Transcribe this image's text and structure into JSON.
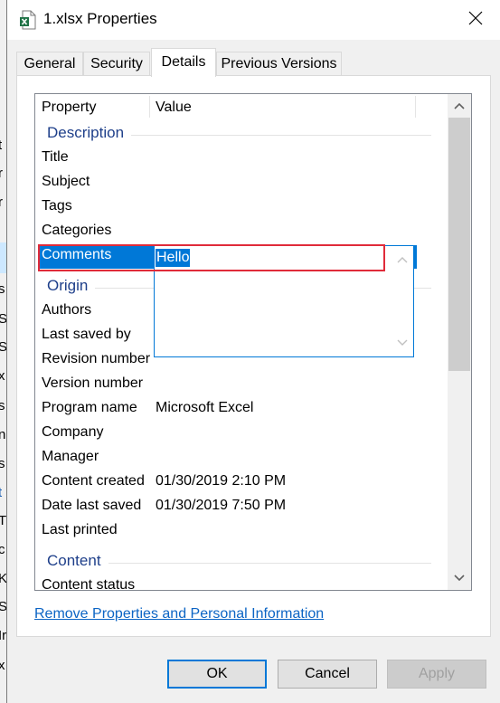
{
  "window": {
    "title": "1.xlsx Properties"
  },
  "tabs": [
    {
      "label": "General"
    },
    {
      "label": "Security"
    },
    {
      "label": "Details"
    },
    {
      "label": "Previous Versions"
    }
  ],
  "list": {
    "header": {
      "property": "Property",
      "value": "Value"
    },
    "groups": {
      "description": "Description",
      "origin": "Origin",
      "content": "Content"
    },
    "rows": {
      "title": {
        "p": "Title",
        "v": ""
      },
      "subject": {
        "p": "Subject",
        "v": ""
      },
      "tags": {
        "p": "Tags",
        "v": ""
      },
      "categories": {
        "p": "Categories",
        "v": ""
      },
      "comments": {
        "p": "Comments",
        "v": "Hello"
      },
      "authors": {
        "p": "Authors",
        "v": ""
      },
      "last_saved_by": {
        "p": "Last saved by",
        "v": ""
      },
      "revision_number": {
        "p": "Revision number",
        "v": ""
      },
      "version_number": {
        "p": "Version number",
        "v": ""
      },
      "program_name": {
        "p": "Program name",
        "v": "Microsoft Excel"
      },
      "company": {
        "p": "Company",
        "v": ""
      },
      "manager": {
        "p": "Manager",
        "v": ""
      },
      "content_created": {
        "p": "Content created",
        "v": "01/30/2019 2:10 PM"
      },
      "date_last_saved": {
        "p": "Date last saved",
        "v": "01/30/2019 7:50 PM"
      },
      "last_printed": {
        "p": "Last printed",
        "v": ""
      },
      "content_status": {
        "p": "Content status",
        "v": ""
      }
    }
  },
  "remove_link": "Remove Properties and Personal Information",
  "buttons": {
    "ok": "OK",
    "cancel": "Cancel",
    "apply": "Apply"
  },
  "colors": {
    "accent": "#0078d7",
    "highlight": "#e02b3a",
    "group_text": "#1e3f8a",
    "link": "#0b64c4"
  },
  "background_fragments": [
    "t",
    "r",
    "r",
    "s",
    "S",
    "S",
    "x",
    "s",
    "n",
    "s",
    "t",
    "T",
    "c",
    "K",
    "S",
    "Ir",
    "x"
  ]
}
